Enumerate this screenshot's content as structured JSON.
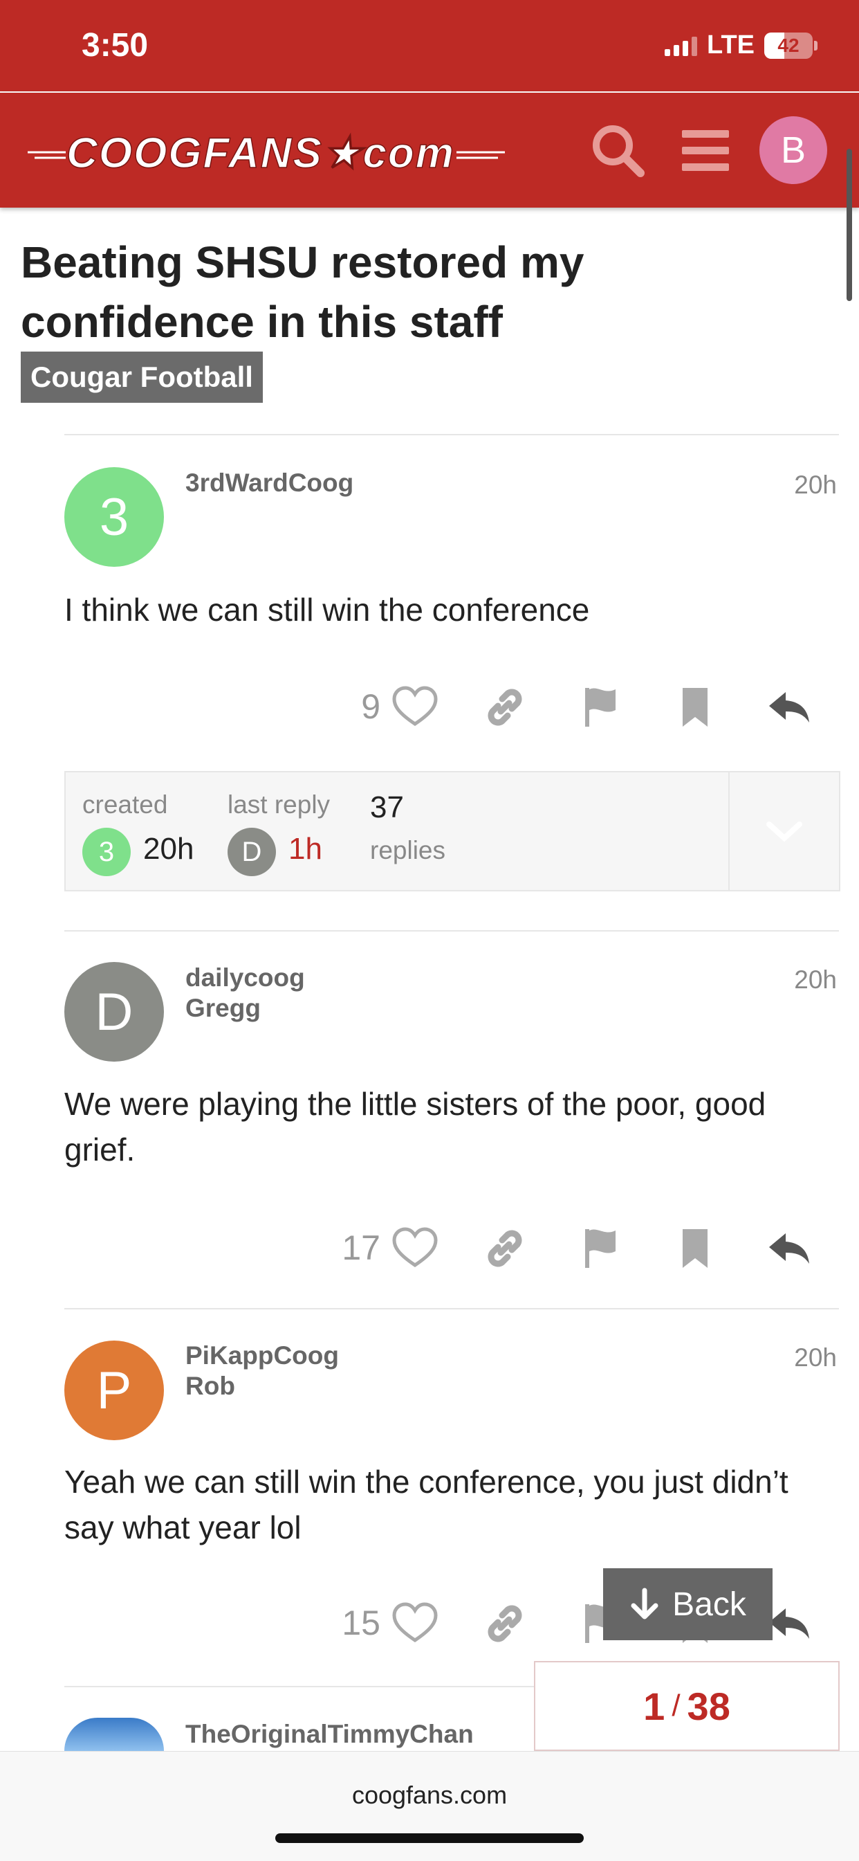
{
  "status_bar": {
    "time": "3:50",
    "network": "LTE",
    "battery": "42",
    "battery_level": 0.42
  },
  "header": {
    "logo_text": "COOGFANS★com",
    "avatar_letter": "B",
    "icons": {
      "search": "search-icon",
      "menu": "hamburger-menu-icon"
    }
  },
  "topic": {
    "title": "Beating SHSU restored my confidence in this staff",
    "category": "Cougar Football"
  },
  "posts": [
    {
      "avatar_letter": "3",
      "avatar_color": "#7fe08b",
      "username": "3rdWardCoog",
      "full_name": "",
      "time": "20h",
      "body": "I think we can still win the conference",
      "likes": "9"
    },
    {
      "avatar_letter": "D",
      "avatar_color": "#8a8c87",
      "username": "dailycoog",
      "full_name": "Gregg",
      "time": "20h",
      "body": "We were playing the little sisters of the poor, good grief.",
      "likes": "17"
    },
    {
      "avatar_letter": "P",
      "avatar_color": "#e07a35",
      "username": "PiKappCoog",
      "full_name": "Rob",
      "time": "20h",
      "body": "Yeah we can still win the conference, you just didn’t say what year lol",
      "likes": "15"
    },
    {
      "avatar_letter": "",
      "avatar_color": "#3a7bc8",
      "username": "TheOriginalTimmyChan",
      "full_name": "",
      "time": "",
      "body": "",
      "likes": ""
    }
  ],
  "topic_map": {
    "created_label": "created",
    "created_avatar": "3",
    "created_time": "20h",
    "last_reply_label": "last reply",
    "last_reply_avatar": "D",
    "last_reply_time": "1h",
    "replies_count": "37",
    "replies_label": "replies"
  },
  "navigation": {
    "back_label": "Back",
    "current": "1",
    "total": "38",
    "separator": "/"
  },
  "browser": {
    "url": "coogfans.com"
  },
  "colors": {
    "brand_red": "#bd2a25",
    "muted": "#999999",
    "reply_time": "#bd2a25"
  }
}
